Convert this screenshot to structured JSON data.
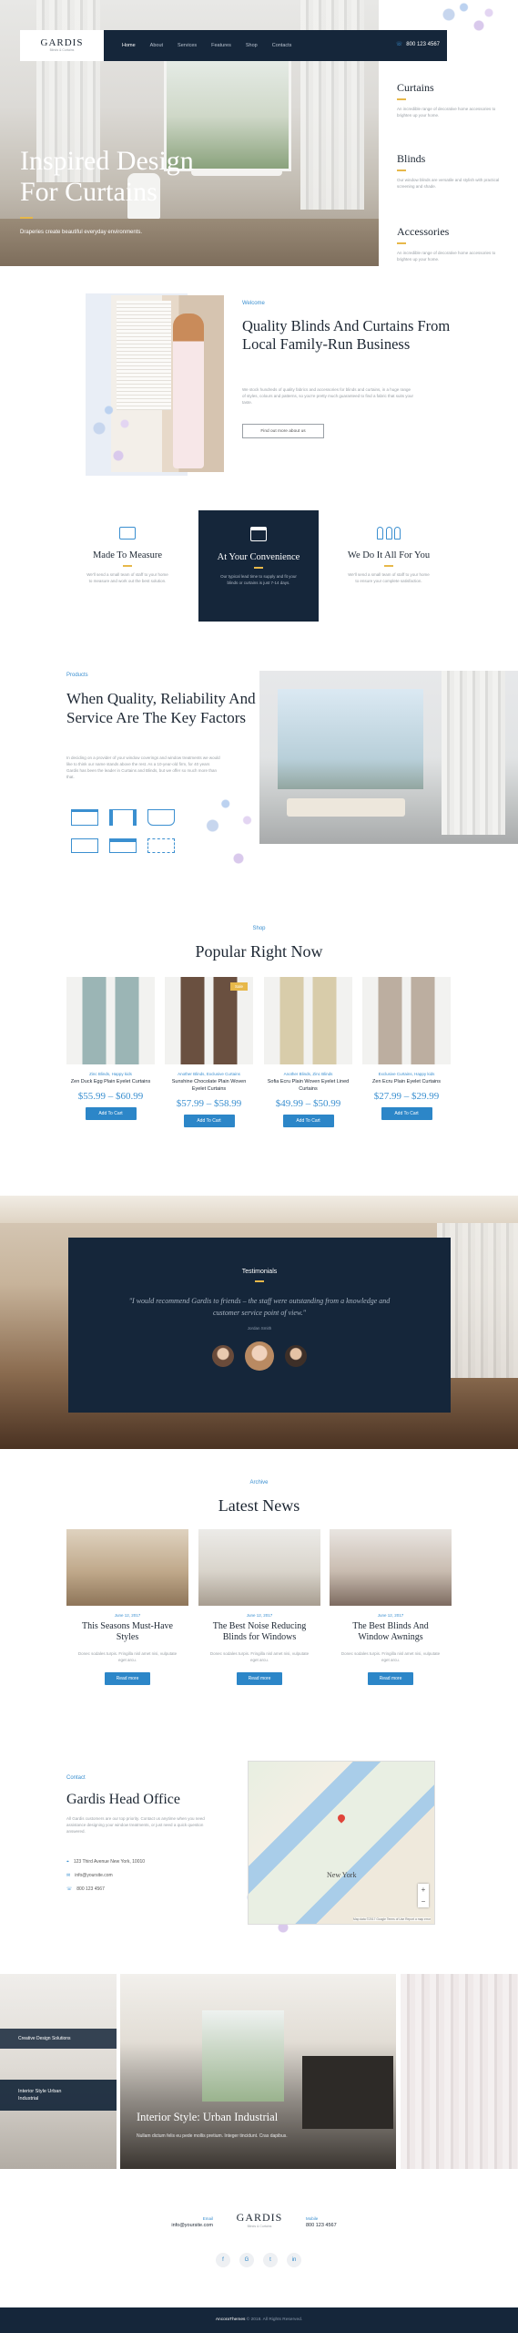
{
  "header": {
    "logo": "GARDIS",
    "logo_sub": "Blinds & Curtains",
    "nav": [
      "Home",
      "About",
      "Services",
      "Features",
      "Shop",
      "Contacts"
    ],
    "phone": "800 123 4567"
  },
  "hero": {
    "title_line1": "Inspired Design",
    "title_line2": "For Curtains",
    "subtitle": "Draperies create beautiful everyday environments.",
    "side": [
      {
        "title": "Curtains",
        "text": "An incredible range of decorative home accessories to brighten up your home."
      },
      {
        "title": "Blinds",
        "text": "Our window blinds are versatile and stylish with practical screening and shade."
      },
      {
        "title": "Accessories",
        "text": "An incredible range of decorative home accessories to brighten up your home."
      }
    ]
  },
  "welcome": {
    "eyebrow": "Welcome",
    "title": "Quality Blinds And Curtains From Local Family-Run Business",
    "text": "We stock hundreds of quality fabrics and accessories for blinds and curtains, in a huge range of styles, colours and patterns, so you're pretty much guaranteed to find a fabric that suits your taste.",
    "button": "Find out more about us"
  },
  "features": [
    {
      "title": "Made To Measure",
      "text": "We'll send a small team of staff to your home to measure and work out the best solution.",
      "icon": "ruler-icon"
    },
    {
      "title": "At Your Convenience",
      "text": "Our typical lead time to supply and fit your blinds or curtains is just 7-14 days.",
      "icon": "calendar-icon"
    },
    {
      "title": "We Do It All For You",
      "text": "We'll send a small team of staff to your home to ensure your complete satisfaction.",
      "icon": "team-icon"
    }
  ],
  "products": {
    "eyebrow": "Products",
    "title": "When Quality, Reliability And Service Are The Key Factors",
    "text": "In deciding on a provider of your window coverings and window treatments we would like to think our name stands above the rest. As a 10-year-old firm, for 40 years Gardis has been the leader in Curtains and Blinds, but we offer so much more than that."
  },
  "shop": {
    "eyebrow": "Shop",
    "title": "Popular Right Now",
    "items": [
      {
        "cat": "Zinc Blinds, Happy kids",
        "name": "Zen Duck Egg Plain Eyelet Curtains",
        "price": "$55.99 – $60.99",
        "button": "Add To Cart",
        "badge": ""
      },
      {
        "cat": "Another Blinds, Exclusive Curtains",
        "name": "Sunshine Chocolate Plain Woven Eyelet Curtains",
        "price": "$57.99 – $58.99",
        "button": "Add To Cart",
        "badge": "Sale"
      },
      {
        "cat": "Another Blinds, Zinc Blinds",
        "name": "Sofia Ecru Plain Woven Eyelet Lined Curtains",
        "price": "$49.99 – $50.99",
        "button": "Add To Cart",
        "badge": ""
      },
      {
        "cat": "Exclusive Curtains, Happy kids",
        "name": "Zen Ecru Plain Eyelet Curtains",
        "price": "$27.99 – $29.99",
        "button": "Add To Cart",
        "badge": ""
      }
    ]
  },
  "testimonial": {
    "title": "Testimonials",
    "quote": "\"I would recommend Gardis to friends – the staff were outstanding from a knowledge and customer service point of view.\"",
    "author": "Jordan Smith"
  },
  "news": {
    "eyebrow": "Archive",
    "title": "Latest News",
    "posts": [
      {
        "date": "June 12, 2017",
        "title": "This Seasons Must-Have Styles",
        "text": "Donec sodales turpis. Fringilla nisl amet nisi, vulputate eget arcu.",
        "button": "Read more"
      },
      {
        "date": "June 12, 2017",
        "title": "The Best Noise Reducing Blinds for Windows",
        "text": "Donec sodales turpis. Fringilla nisl amet nisi, vulputate eget arcu.",
        "button": "Read more"
      },
      {
        "date": "June 12, 2017",
        "title": "The Best Blinds And Window Awnings",
        "text": "Donec sodales turpis. Fringilla nisl amet nisi, vulputate eget arcu.",
        "button": "Read more"
      }
    ]
  },
  "contact": {
    "eyebrow": "Contact",
    "title": "Gardis Head Office",
    "text": "All Gardis customers are our top priority. Contact us anytime when you need assistance designing your window treatments, or just need a quick question answered.",
    "address": "123 Third Avenue New York, 10010",
    "email": "info@yoursite.com",
    "phone": "800 123 4567",
    "map_label": "New York",
    "map_note": "Map data ©2017 Google  Terms of Use  Report a map error"
  },
  "gallery": {
    "card1": "Creative Design Solutions",
    "card2_line1": "Interior Style Urban",
    "card2_line2": "Industrial",
    "main_title": "Interior Style: Urban Industrial",
    "main_text": "Nullam dictum felis eu pede mollis pretium. Integer tincidunt. Cras dapibus."
  },
  "footer": {
    "email_label": "Email",
    "email": "info@yoursite.com",
    "logo": "GARDIS",
    "logo_sub": "Blinds & Curtains",
    "phone_label": "Mobile",
    "phone": "800 123 4567",
    "social": [
      "f",
      "G",
      "t",
      "in"
    ],
    "copyright_brand": "AncoraThemes",
    "copyright": "© 2018. All Rights Reserved."
  },
  "colors": {
    "navy": "#15263a",
    "accent": "#2c86c8",
    "gold": "#e7b84a"
  }
}
